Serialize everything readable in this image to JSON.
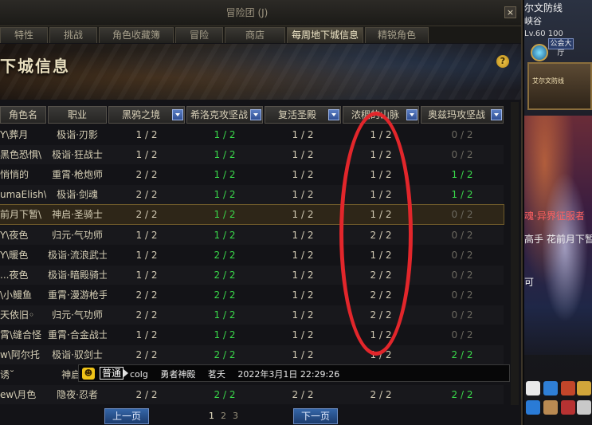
{
  "window": {
    "title": "冒险团 (J)",
    "close": "×"
  },
  "tabs": [
    {
      "label": "特性",
      "active": false
    },
    {
      "label": "挑战",
      "active": false
    },
    {
      "label": "角色收藏簿",
      "active": false
    },
    {
      "label": "冒险",
      "active": false
    },
    {
      "label": "商店",
      "active": false
    },
    {
      "label": "每周地下城信息",
      "active": true
    },
    {
      "label": "精锐角色",
      "active": false
    }
  ],
  "banner": {
    "title": "下城信息",
    "help": "?"
  },
  "table": {
    "headers": [
      "角色名",
      "职业",
      "黑鸦之境",
      "希洛克攻坚战",
      "复活圣殿",
      "浓稠的山脉",
      "奥兹玛攻坚战"
    ],
    "rows": [
      {
        "name": "Y\\葬月",
        "job": "极诣·刃影",
        "v": [
          "1 / 2",
          "1 / 2",
          "1 / 2",
          "1 / 2",
          "0 / 2"
        ]
      },
      {
        "name": "黑色恐惧\\",
        "job": "极诣·狂战士",
        "v": [
          "1 / 2",
          "1 / 2",
          "1 / 2",
          "1 / 2",
          "0 / 2"
        ]
      },
      {
        "name": "悄悄的",
        "job": "重霄·枪炮师",
        "v": [
          "2 / 2",
          "1 / 2",
          "1 / 2",
          "1 / 2",
          "1 / 2"
        ]
      },
      {
        "name": "umaElish\\",
        "job": "极诣·剑魂",
        "v": [
          "2 / 2",
          "1 / 2",
          "1 / 2",
          "1 / 2",
          "1 / 2"
        ]
      },
      {
        "name": "前月下暂\\",
        "job": "神启·圣骑士",
        "v": [
          "2 / 2",
          "1 / 2",
          "1 / 2",
          "1 / 2",
          "0 / 2"
        ]
      },
      {
        "name": "Y\\夜色",
        "job": "归元·气功师",
        "v": [
          "1 / 2",
          "1 / 2",
          "1 / 2",
          "2 / 2",
          "0 / 2"
        ]
      },
      {
        "name": "Y\\暖色",
        "job": "极诣·流浪武士",
        "v": [
          "1 / 2",
          "2 / 2",
          "1 / 2",
          "1 / 2",
          "0 / 2"
        ]
      },
      {
        "name": "...夜色",
        "job": "极诣·暗殿骑士",
        "v": [
          "1 / 2",
          "2 / 2",
          "1 / 2",
          "2 / 2",
          "0 / 2"
        ]
      },
      {
        "name": "\\小鳗鱼",
        "job": "重霄·漫游枪手",
        "v": [
          "2 / 2",
          "2 / 2",
          "1 / 2",
          "2 / 2",
          "0 / 2"
        ]
      },
      {
        "name": "天依旧◦",
        "job": "归元·气功师",
        "v": [
          "2 / 2",
          "1 / 2",
          "1 / 2",
          "2 / 2",
          "0 / 2"
        ]
      },
      {
        "name": "霄\\缝合怪",
        "job": "重霄·合金战士",
        "v": [
          "1 / 2",
          "1 / 2",
          "1 / 2",
          "1 / 2",
          "0 / 2"
        ]
      },
      {
        "name": "w\\阿尔托",
        "job": "极诣·驭剑士",
        "v": [
          "2 / 2",
          "2 / 2",
          "1 / 2",
          "1 / 2",
          "2 / 2"
        ]
      },
      {
        "name": "诱˘",
        "job": "神启·诱",
        "v": [
          "",
          "",
          "",
          "",
          ""
        ]
      },
      {
        "name": "ew\\月色",
        "job": "隐夜·忍者",
        "v": [
          "2 / 2",
          "2 / 2",
          "2 / 2",
          "2 / 2",
          "2 / 2"
        ]
      }
    ]
  },
  "chat": {
    "emoji": "☻",
    "channel": "普通",
    "source": "colg",
    "server": "勇者神殿",
    "user": "茗夭",
    "time": "2022年3月1日 22:29:26"
  },
  "pagination": {
    "prev": "上一页",
    "next": "下一页",
    "pages": [
      "1",
      "2",
      "3"
    ],
    "current": "1"
  },
  "side": {
    "title": "尔文防线",
    "sub": "峡谷",
    "lv": "Lv.60 100",
    "guild": "公会大厅",
    "map_label": "艾尔文防线",
    "red_text": "魂·异界征服者",
    "white_text": "高手 花前月下暂",
    "white_text2": "可"
  },
  "colors": {
    "green": "#39d84a",
    "annotation": "#e2262b"
  }
}
